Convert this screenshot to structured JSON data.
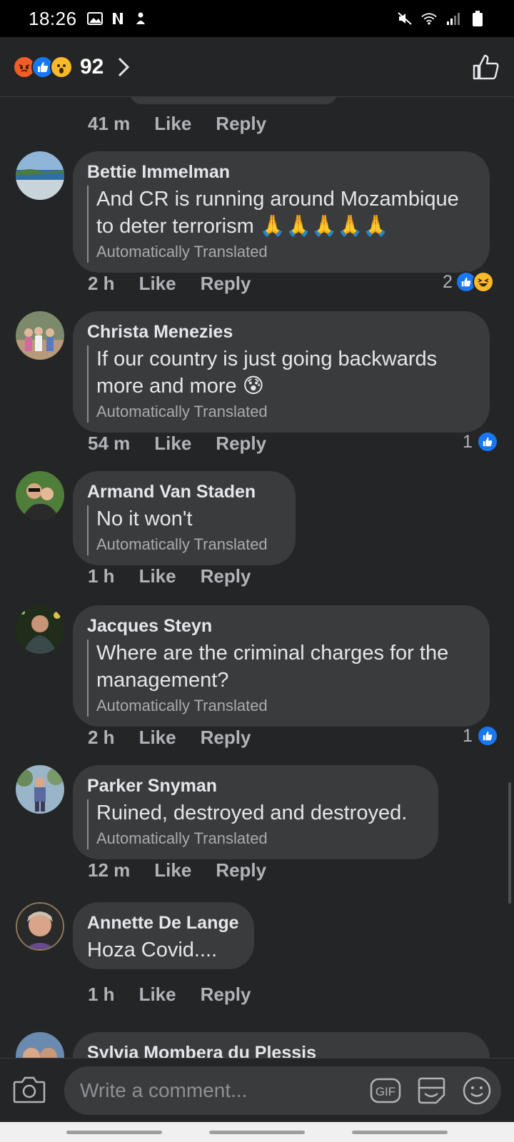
{
  "status_bar": {
    "time": "18:26"
  },
  "header": {
    "reaction_count": "92",
    "reactions": [
      "angry",
      "like",
      "wow"
    ]
  },
  "previous_comment": {
    "time": "41 m",
    "like": "Like",
    "reply": "Reply"
  },
  "comments": [
    {
      "author": "Bettie Immelman",
      "text": "And CR is running around Mozambique to deter terrorism 🙏🙏🙏🙏🙏",
      "translated_label": "Automatically Translated",
      "time": "2 h",
      "like": "Like",
      "reply": "Reply",
      "reaction_count": "2",
      "reactions": [
        "like",
        "haha"
      ]
    },
    {
      "author": "Christa Menezies",
      "text": "If our country is just going backwards more and more 😰",
      "translated_label": "Automatically Translated",
      "time": "54 m",
      "like": "Like",
      "reply": "Reply",
      "reaction_count": "1",
      "reactions": [
        "like"
      ]
    },
    {
      "author": "Armand Van Staden",
      "text": "No it won't",
      "translated_label": "Automatically Translated",
      "time": "1 h",
      "like": "Like",
      "reply": "Reply"
    },
    {
      "author": "Jacques Steyn",
      "text": "Where are the criminal charges for the management?",
      "translated_label": "Automatically Translated",
      "time": "2 h",
      "like": "Like",
      "reply": "Reply",
      "reaction_count": "1",
      "reactions": [
        "like"
      ]
    },
    {
      "author": "Parker Snyman",
      "text": "Ruined, destroyed and destroyed.",
      "translated_label": "Automatically Translated",
      "time": "12 m",
      "like": "Like",
      "reply": "Reply"
    },
    {
      "author": "Annette De Lange",
      "text": "Hoza Covid....",
      "time": "1 h",
      "like": "Like",
      "reply": "Reply"
    },
    {
      "author": "Sylvia Mombera du Plessis"
    }
  ],
  "composer": {
    "placeholder": "Write a comment...",
    "gif_label": "GIF"
  },
  "colors": {
    "background": "#242526",
    "bubble": "#3a3b3c",
    "like_blue": "#1877f2",
    "angry": "#f25c26",
    "wow": "#f7b928"
  }
}
